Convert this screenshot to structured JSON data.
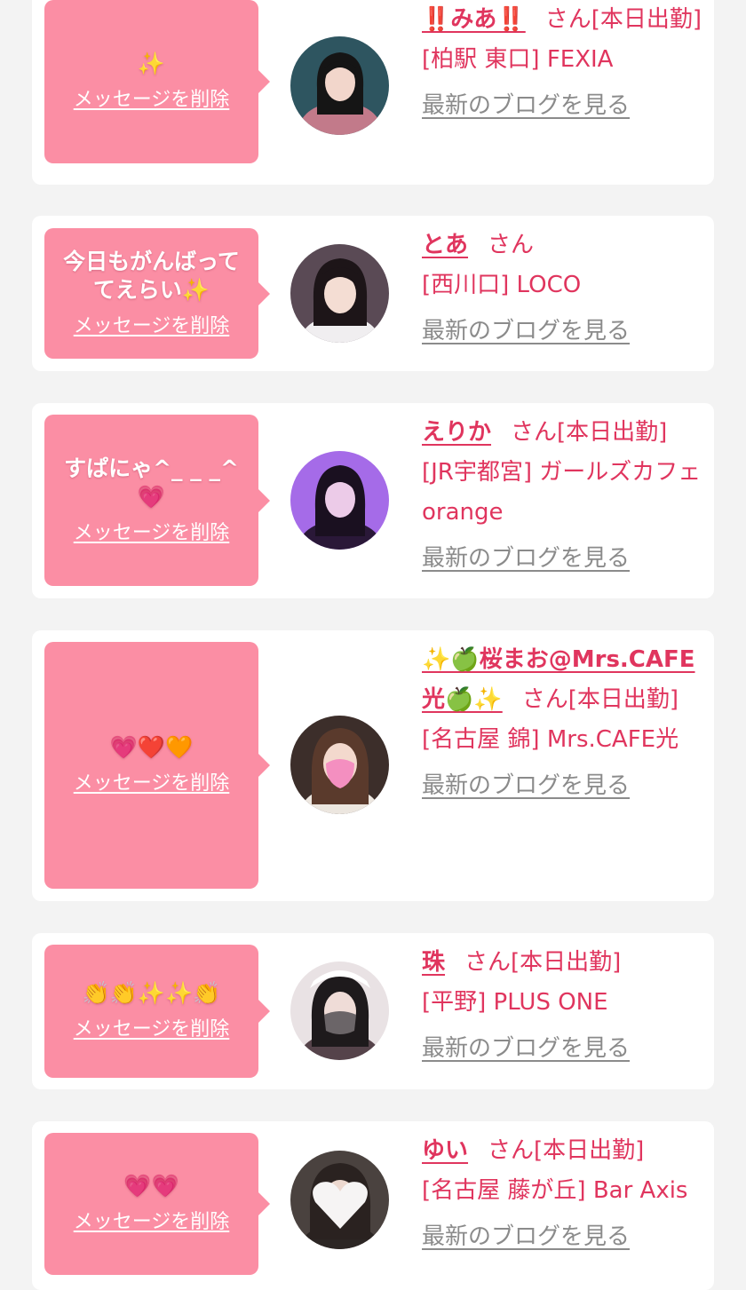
{
  "delete_label": "メッセージを削除",
  "blog_label": "最新のブログを見る",
  "honorific": "さん",
  "colors": {
    "background": "#f3f3f3",
    "card": "#ffffff",
    "bubble": "#fb8ea4",
    "accent_text": "#e0355e",
    "link_gray": "#8b8b8b"
  },
  "cards": [
    {
      "message": "✨",
      "name": "‼️みあ‼️",
      "status": "[本日出勤]",
      "shop": "[柏駅 東口] FEXIA",
      "avatar_icon": "girl-photo-icon"
    },
    {
      "message": "今日もがんばって\nてえらい✨",
      "name": "とあ",
      "status": "",
      "shop": "[西川口] LOCO",
      "avatar_icon": "girl-photo-icon"
    },
    {
      "message": "すぱにゃ^_ _ _^\n💗",
      "name": "えりか",
      "status": "[本日出勤]",
      "shop": "[JR宇都宮] ガールズカフェ orange",
      "avatar_icon": "girl-photo-icon"
    },
    {
      "message": "💗❤️🧡",
      "name": "✨🍏桜まお@Mrs.CAFE光🍏✨",
      "status": "[本日出勤]",
      "shop": "[名古屋 錦] Mrs.CAFE光",
      "avatar_icon": "girl-photo-icon"
    },
    {
      "message": "👏👏✨✨👏",
      "name": "珠",
      "status": "[本日出勤]",
      "shop": "[平野] PLUS ONE",
      "avatar_icon": "girl-photo-icon"
    },
    {
      "message": "💗💗",
      "name": "ゆい",
      "status": "[本日出勤]",
      "shop": "[名古屋 藤が丘] Bar Axis",
      "avatar_icon": "girl-photo-icon"
    }
  ]
}
